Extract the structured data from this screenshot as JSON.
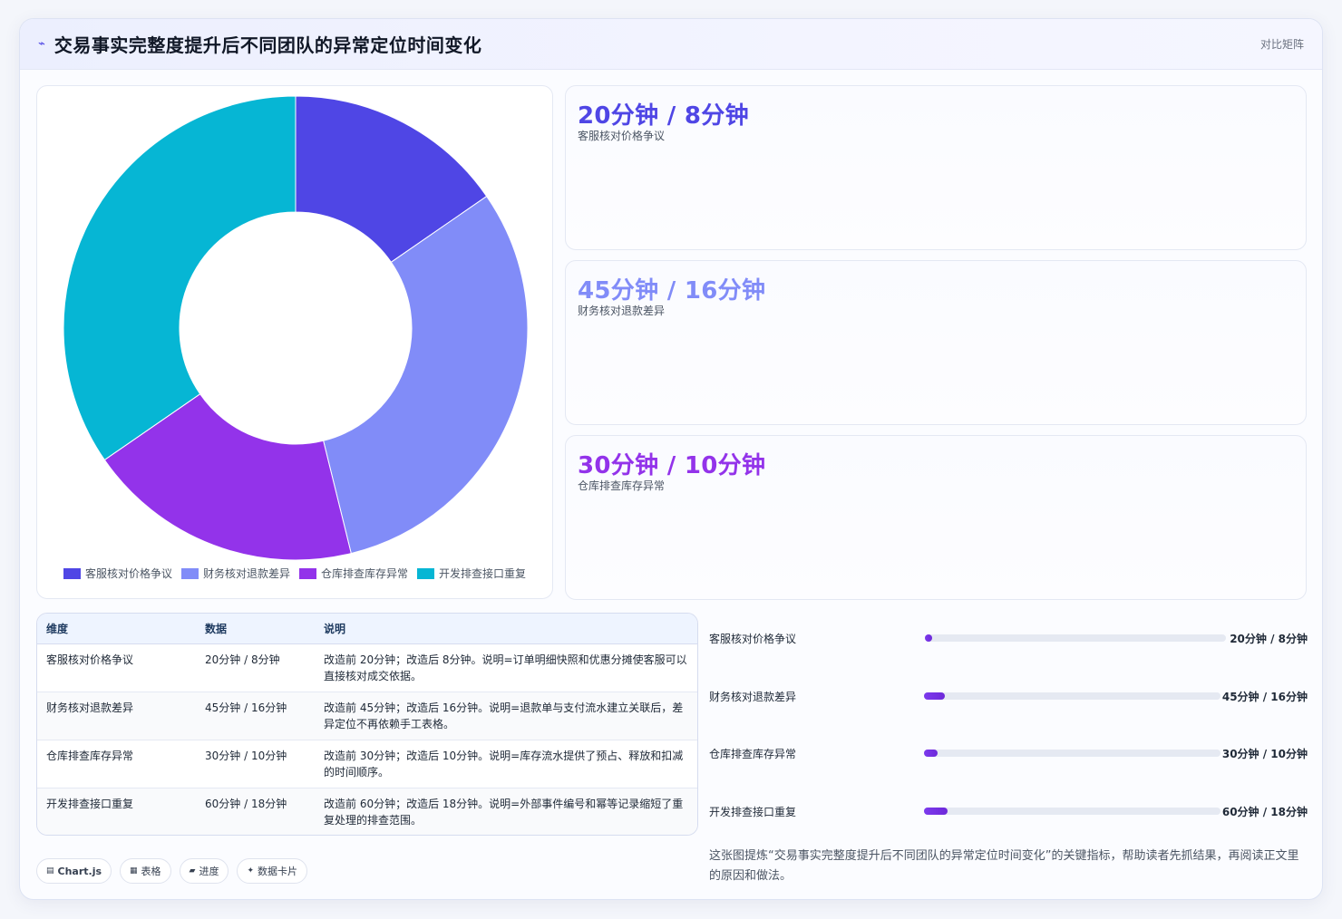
{
  "header": {
    "icon": "spark-icon",
    "title": "交易事实完整度提升后不同团队的异常定位时间变化",
    "tag": "对比矩阵"
  },
  "colors": {
    "series": [
      "#4f46e5",
      "#818cf8",
      "#9333ea",
      "#06b6d4"
    ],
    "accent": "#4f46e5"
  },
  "chart_data": {
    "type": "pie",
    "variant": "doughnut",
    "categories": [
      "客服核对价格争议",
      "财务核对退款差异",
      "仓库排查库存异常",
      "开发排查接口重复"
    ],
    "values": [
      8,
      16,
      10,
      18
    ],
    "legend_position": "bottom"
  },
  "stats": [
    {
      "value": "20分钟 / 8分钟",
      "label": "客服核对价格争议",
      "color": "#4f46e5"
    },
    {
      "value": "45分钟 / 16分钟",
      "label": "财务核对退款差异",
      "color": "#818cf8"
    },
    {
      "value": "30分钟 / 10分钟",
      "label": "仓库排查库存异常",
      "color": "#9333ea"
    }
  ],
  "table": {
    "headers": [
      "维度",
      "数据",
      "说明"
    ],
    "rows": [
      [
        "客服核对价格争议",
        "20分钟 / 8分钟",
        "改造前 20分钟；改造后 8分钟。说明=订单明细快照和优惠分摊使客服可以直接核对成交依据。"
      ],
      [
        "财务核对退款差异",
        "45分钟 / 16分钟",
        "改造前 45分钟；改造后 16分钟。说明=退款单与支付流水建立关联后，差异定位不再依赖手工表格。"
      ],
      [
        "仓库排查库存异常",
        "30分钟 / 10分钟",
        "改造前 30分钟；改造后 10分钟。说明=库存流水提供了预占、释放和扣减的时间顺序。"
      ],
      [
        "开发排查接口重复",
        "60分钟 / 18分钟",
        "改造前 60分钟；改造后 18分钟。说明=外部事件编号和幂等记录缩短了重复处理的排查范围。"
      ]
    ]
  },
  "progress": [
    {
      "label": "客服核对价格争议",
      "value": "20分钟 / 8分钟",
      "fraction": 0.02
    },
    {
      "label": "财务核对退款差异",
      "value": "45分钟 / 16分钟",
      "fraction": 0.07
    },
    {
      "label": "仓库排查库存异常",
      "value": "30分钟 / 10分钟",
      "fraction": 0.045
    },
    {
      "label": "开发排查接口重复",
      "value": "60分钟 / 18分钟",
      "fraction": 0.08
    }
  ],
  "note": "这张图提炼“交易事实完整度提升后不同团队的异常定位时间变化”的关键指标，帮助读者先抓结果，再阅读正文里的原因和做法。",
  "chips": [
    {
      "icon": "chart-icon",
      "label": "Chart.js"
    },
    {
      "icon": "table-icon",
      "label": "表格"
    },
    {
      "icon": "progress-icon",
      "label": "进度"
    },
    {
      "icon": "sparkle-icon",
      "label": "数据卡片"
    }
  ]
}
